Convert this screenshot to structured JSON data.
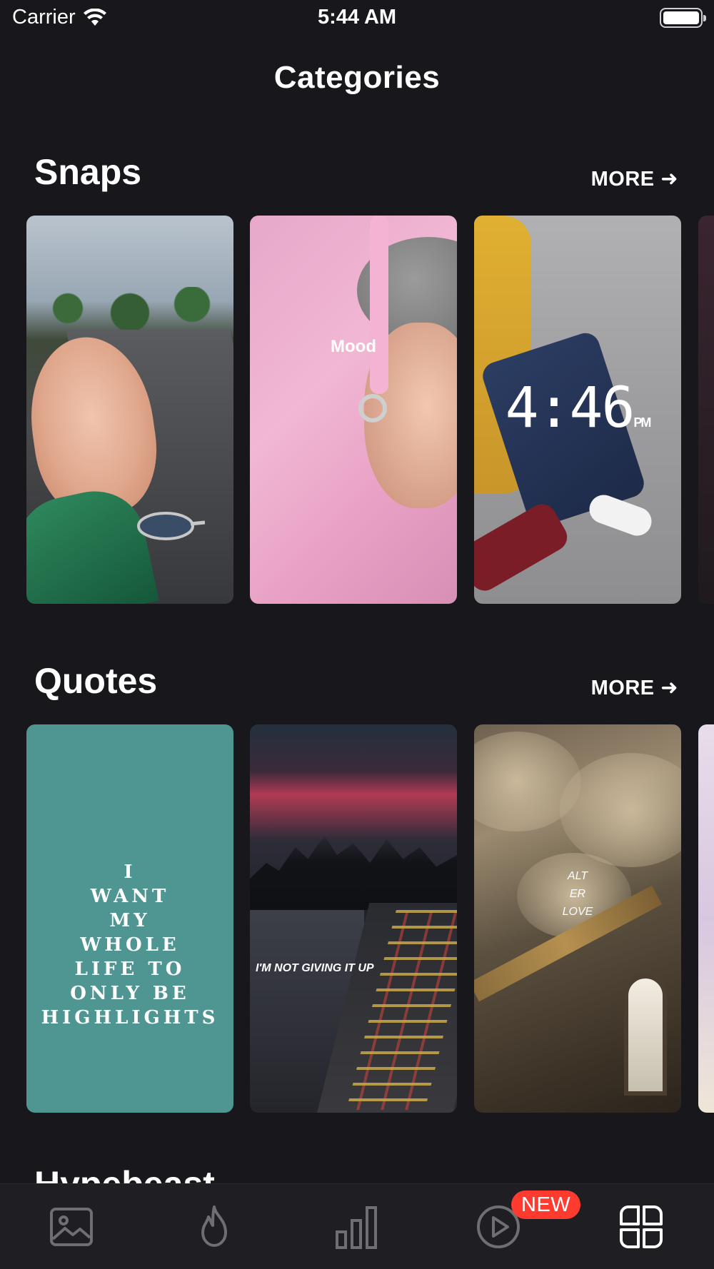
{
  "status_bar": {
    "carrier": "Carrier",
    "time": "5:44 AM"
  },
  "nav": {
    "title": "Categories"
  },
  "sections": [
    {
      "title": "Snaps",
      "more_label": "MORE ➜",
      "cards": [
        {
          "overlay": ""
        },
        {
          "overlay": "Mood"
        },
        {
          "overlay": "4:46",
          "overlay_suffix": "PM"
        },
        {
          "overlay": ""
        }
      ]
    },
    {
      "title": "Quotes",
      "more_label": "MORE ➜",
      "cards": [
        {
          "overlay": "I\nWANT\nMY\nWHOLE\nLIFE TO\nONLY BE\nHIGHLIGHTS"
        },
        {
          "overlay": "I'M NOT GIVING IT UP"
        },
        {
          "overlay": "ALT\nER\nLOVE"
        },
        {
          "overlay": ""
        }
      ]
    },
    {
      "title": "Hypebeast"
    }
  ],
  "tab_bar": {
    "tabs": [
      {
        "icon": "image-icon"
      },
      {
        "icon": "flame-icon"
      },
      {
        "icon": "bar-chart-icon"
      },
      {
        "icon": "play-circle-icon",
        "badge": "NEW"
      },
      {
        "icon": "grid-icon",
        "active": true
      }
    ]
  },
  "colors": {
    "background": "#17171c",
    "tab_bar": "#1e1e23",
    "badge": "#ff3b30",
    "quote_teal": "#4f9692",
    "quote_text": "#f0b35c"
  }
}
